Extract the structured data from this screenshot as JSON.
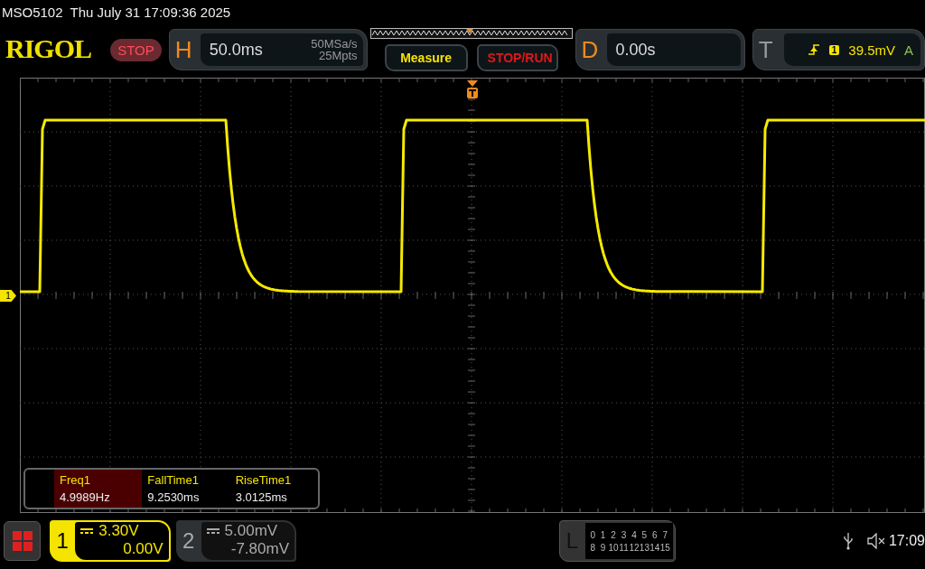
{
  "status_line": {
    "model": "MSO5102",
    "datetime": "Thu July 31 17:09:36 2025"
  },
  "toolbar": {
    "logo": "RIGOL",
    "run_state": "STOP",
    "horizontal": {
      "label": "H",
      "timebase": "50.0ms",
      "sample_rate": "50MSa/s",
      "memory_depth": "25Mpts"
    },
    "measure_button": "Measure",
    "run_button": "STOP/RUN",
    "delay": {
      "label": "D",
      "value": "0.00s"
    },
    "trigger": {
      "label": "T",
      "source": "1",
      "level": "39.5mV",
      "mode": "A"
    }
  },
  "scope": {
    "channel_marker": "1",
    "measurements": [
      {
        "name": "Freq1",
        "value": "4.9989Hz",
        "selected": true
      },
      {
        "name": "FallTime1",
        "value": "9.2530ms",
        "selected": false
      },
      {
        "name": "RiseTime1",
        "value": "3.0125ms",
        "selected": false
      }
    ]
  },
  "channels": [
    {
      "number": "1",
      "scale": "3.30V",
      "offset": "0.00V",
      "enabled": true
    },
    {
      "number": "2",
      "scale": "5.00mV",
      "offset": "-7.80mV",
      "enabled": false
    }
  ],
  "logic": {
    "label": "L",
    "bits": [
      "0",
      "1",
      "2",
      "3",
      "4",
      "5",
      "6",
      "7",
      "8",
      "9",
      "10",
      "11",
      "12",
      "13",
      "14",
      "15"
    ]
  },
  "clock": "17:09"
}
